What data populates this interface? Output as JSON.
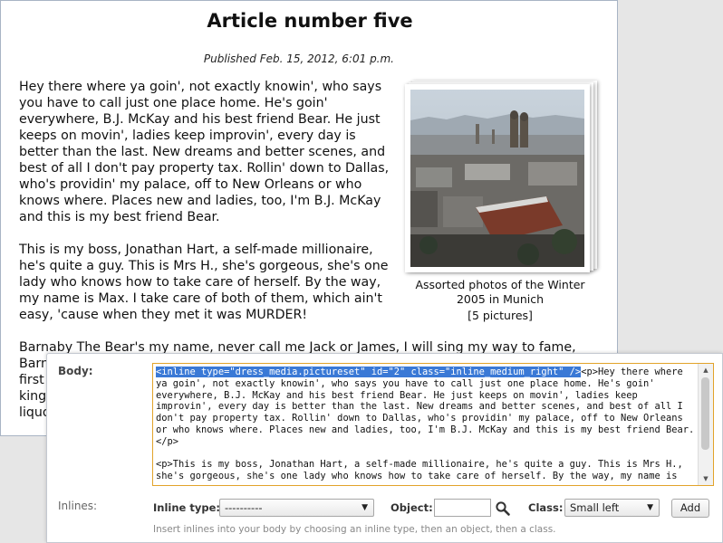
{
  "article": {
    "title": "Article number five",
    "published": "Published Feb. 15, 2012, 6:01 p.m.",
    "paragraphs": [
      "Hey there where ya goin', not exactly knowin', who says you have to call just one place home. He's goin' everywhere, B.J. McKay and his best friend Bear. He just keeps on movin', ladies keep improvin', every day is better than the last. New dreams and better scenes, and best of all I don't pay property tax. Rollin' down to Dallas, who's providin' my palace, off to New Orleans or who knows where. Places new and ladies, too, I'm B.J. McKay and this is my best friend Bear.",
      "This is my boss, Jonathan Hart, a self-made millionaire, he's quite a guy. This is Mrs H., she's gorgeous, she's one lady who knows how to take care of herself. By the way, my name is Max. I take care of both of them, which ain't easy, 'cause when they met it was MURDER!",
      "Barnaby The Bear's my name, never call me Jack or James, I will sing my way to fame, Barnaby the Bear's my name. Birds taught me to sing, when they took me to their king, first I had to fly, in the sky so high so high, so high I could almost touch the sky, then the king said to me, if you want to learn to sing, tune in to the song in your heart, lick the liquor with your lips, la la la la la la la la la la la, call me Jack or James."
    ],
    "photo_caption": "Assorted photos of the Winter 2005 in Munich",
    "photo_count": "[5 pictures]"
  },
  "form": {
    "body_label": "Body:",
    "body_selected": "<inline type=\"dress_media.pictureset\" id=\"2\" class=\"inline_medium_right\" />",
    "body_rest": "<p>Hey there where ya goin', not exactly knowin', who says you have to call just one place home. He's goin' everywhere, B.J. McKay and his best friend Bear. He just keeps on movin', ladies keep improvin', every day is better than the last. New dreams and better scenes, and best of all I don't pay property tax. Rollin' down to Dallas, who's providin' my palace, off to New Orleans or who knows where. Places new and ladies, too, I'm B.J. McKay and this is my best friend Bear.</p>\n\n<p>This is my boss, Jonathan Hart, a self-made millionaire, he's quite a guy. This is Mrs H., she's gorgeous, she's one lady who knows how to take care of herself. By the way, my name is Max. I take care of both of them, which ain't easy, 'cause when they met it was MURDER!</p>",
    "inlines_label": "Inlines:",
    "inline_type_label": "Inline type:",
    "inline_type_value": "----------",
    "object_label": "Object:",
    "object_value": "",
    "class_label": "Class:",
    "class_value": "Small left",
    "add_label": "Add",
    "help_text": "Insert inlines into your body by choosing an inline type, then an object, then a class."
  },
  "icons": {
    "object_lookup": "search-icon",
    "select_caret": "caret-down-icon"
  },
  "colors": {
    "selection": "#3a79d6",
    "focus_border": "#e2a32a"
  }
}
